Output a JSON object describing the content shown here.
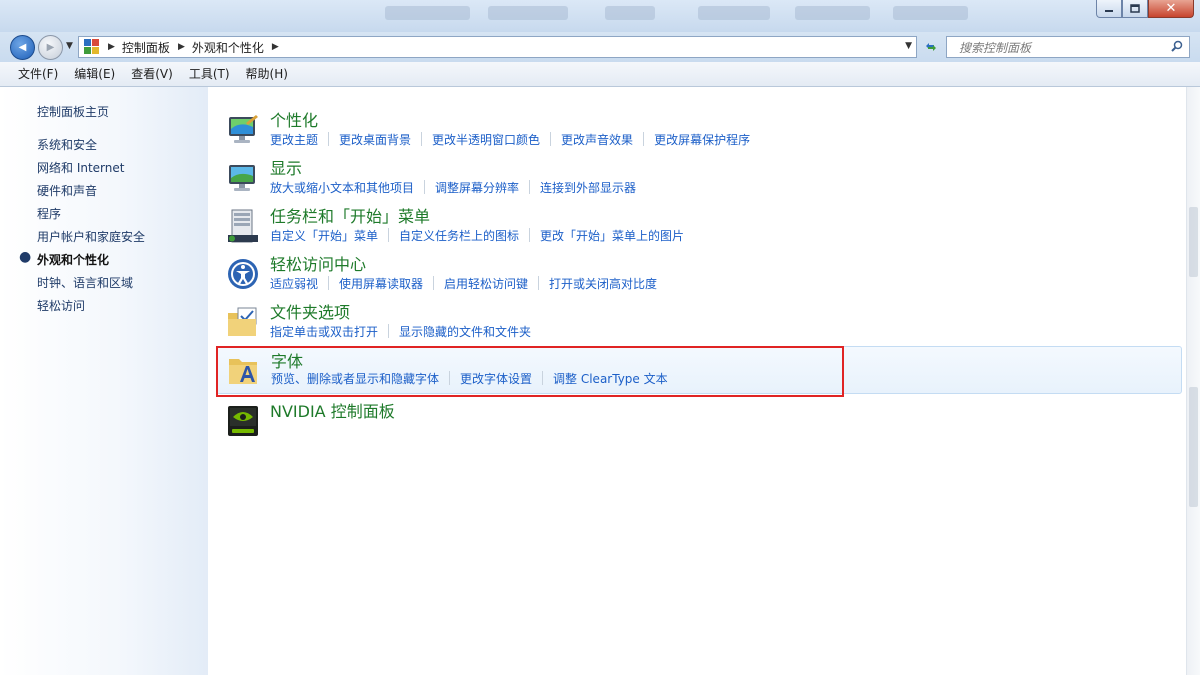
{
  "window": {
    "min_icon": "minimize-icon",
    "max_icon": "maximize-icon",
    "close_glyph": "✕"
  },
  "address_bar": {
    "breadcrumbs": [
      "控制面板",
      "外观和个性化"
    ],
    "back_glyph": "◀",
    "forward_glyph": "▶"
  },
  "search": {
    "placeholder": "搜索控制面板"
  },
  "menu": [
    "文件(F)",
    "编辑(E)",
    "查看(V)",
    "工具(T)",
    "帮助(H)"
  ],
  "sidebar": {
    "home": "控制面板主页",
    "items": [
      "系统和安全",
      "网络和 Internet",
      "硬件和声音",
      "程序",
      "用户帐户和家庭安全",
      "外观和个性化",
      "时钟、语言和区域",
      "轻松访问"
    ],
    "active_index": 5
  },
  "categories": [
    {
      "title": "个性化",
      "icon": "personalization-icon",
      "links": [
        "更改主题",
        "更改桌面背景",
        "更改半透明窗口颜色",
        "更改声音效果",
        "更改屏幕保护程序"
      ]
    },
    {
      "title": "显示",
      "icon": "display-icon",
      "links": [
        "放大或缩小文本和其他项目",
        "调整屏幕分辨率",
        "连接到外部显示器"
      ]
    },
    {
      "title": "任务栏和「开始」菜单",
      "icon": "taskbar-icon",
      "links": [
        "自定义「开始」菜单",
        "自定义任务栏上的图标",
        "更改「开始」菜单上的图片"
      ]
    },
    {
      "title": "轻松访问中心",
      "icon": "ease-of-access-icon",
      "links": [
        "适应弱视",
        "使用屏幕读取器",
        "启用轻松访问键",
        "打开或关闭高对比度"
      ]
    },
    {
      "title": "文件夹选项",
      "icon": "folder-options-icon",
      "links": [
        "指定单击或双击打开",
        "显示隐藏的文件和文件夹"
      ]
    },
    {
      "title": "字体",
      "icon": "fonts-icon",
      "links": [
        "预览、删除或者显示和隐藏字体",
        "更改字体设置",
        "调整 ClearType 文本"
      ]
    },
    {
      "title": "NVIDIA 控制面板",
      "icon": "nvidia-icon",
      "links": []
    }
  ],
  "colors": {
    "title_green": "#1e7a2a",
    "link_blue": "#1c5fc8",
    "highlight_border": "#e02424"
  }
}
